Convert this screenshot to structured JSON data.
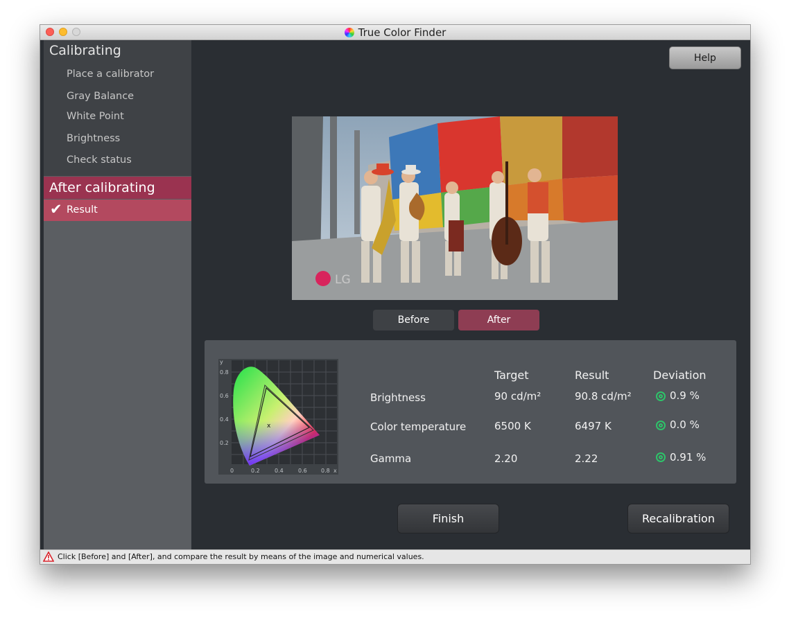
{
  "window": {
    "title": "True Color Finder",
    "app_icon": "color-wheel-icon"
  },
  "sidebar": {
    "section1_title": "Calibrating",
    "items": [
      "Place a calibrator",
      "Gray Balance",
      "White Point",
      "Brightness",
      "Check status"
    ],
    "section2_title": "After calibrating",
    "active_item": "Result",
    "active_icon": "checkmark-icon",
    "accent_color": "#9a3350"
  },
  "main": {
    "help_label": "Help",
    "preview": {
      "logo_text": "LG"
    },
    "toggle": {
      "before_label": "Before",
      "after_label": "After",
      "selected": "After"
    },
    "results": {
      "chart_axis": {
        "y": "y",
        "x": "x",
        "y_ticks": [
          "0.8",
          "0.6",
          "0.4",
          "0.2"
        ],
        "x_ticks": [
          "0",
          "0.2",
          "0.4",
          "0.6",
          "0.8"
        ]
      },
      "headers": {
        "target": "Target",
        "result": "Result",
        "deviation": "Deviation"
      },
      "rows": [
        {
          "label": "Brightness",
          "target": "90 cd/m²",
          "result": "90.8 cd/m²",
          "deviation": "0.9 %"
        },
        {
          "label": "Color temperature",
          "target": "6500 K",
          "result": "6497 K",
          "deviation": "0.0 %"
        },
        {
          "label": "Gamma",
          "target": "2.20",
          "result": "2.22",
          "deviation": "0.91 %"
        }
      ],
      "deviation_icon": "ok-target-icon",
      "ok_color": "#2ec46a"
    },
    "finish_label": "Finish",
    "recalibration_label": "Recalibration"
  },
  "status": {
    "icon": "warning-icon",
    "text": "Click [Before] and [After], and compare the result by means of the image and numerical values."
  }
}
